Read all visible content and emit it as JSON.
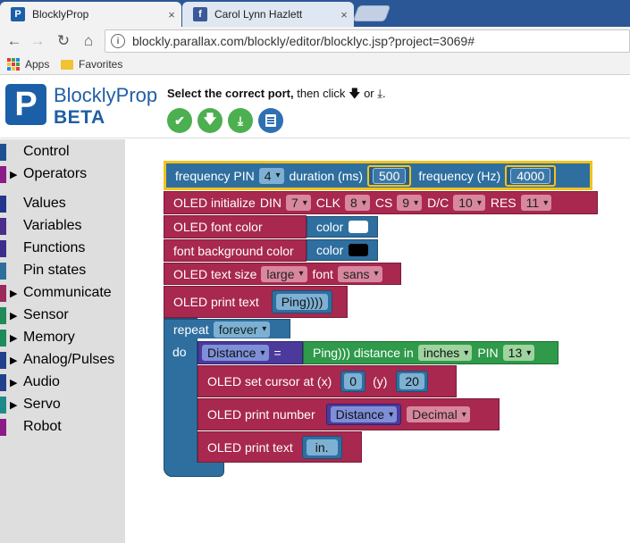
{
  "browser": {
    "tabs": [
      {
        "title": "BlocklyProp",
        "close": "×"
      },
      {
        "title": "Carol Lynn Hazlett",
        "close": "×"
      }
    ],
    "url": "blockly.parallax.com/blockly/editor/blocklyc.jsp?project=3069#",
    "bookmarks": {
      "apps": "Apps",
      "favorites": "Favorites"
    },
    "nav_icons": [
      "back-arrow-icon",
      "forward-arrow-icon",
      "reload-icon",
      "home-icon"
    ]
  },
  "header": {
    "logo_line1": "BlocklyProp",
    "logo_line2": "BETA",
    "message_bold": "Select the correct port,",
    "message_rest": "then click",
    "message_or": "or",
    "message_end": ".",
    "buttons": [
      {
        "name": "compile-button",
        "color": "#4caf50",
        "icon": "check-icon"
      },
      {
        "name": "load-ram-button",
        "color": "#4caf50",
        "icon": "download-icon"
      },
      {
        "name": "load-eeprom-button",
        "color": "#4caf50",
        "icon": "download-bar-icon"
      },
      {
        "name": "serial-terminal-button",
        "color": "#2f6fb3",
        "icon": "terminal-icon"
      }
    ]
  },
  "sidebar": {
    "categories": [
      {
        "label": "Control",
        "color": "#1f4f93",
        "arrow": false
      },
      {
        "label": "Operators",
        "color": "#8b1c88",
        "arrow": true
      },
      {
        "label": "Values",
        "color": "#23358c",
        "arrow": false
      },
      {
        "label": "Variables",
        "color": "#4b2d8c",
        "arrow": false
      },
      {
        "label": "Functions",
        "color": "#3b2d8c",
        "arrow": false
      },
      {
        "label": "Pin states",
        "color": "#2d6e9c",
        "arrow": false
      },
      {
        "label": "Communicate",
        "color": "#9b2a5a",
        "arrow": true
      },
      {
        "label": "Sensor",
        "color": "#1f8a5a",
        "arrow": true
      },
      {
        "label": "Memory",
        "color": "#1f8a5a",
        "arrow": true
      },
      {
        "label": "Analog/Pulses",
        "color": "#22418c",
        "arrow": true
      },
      {
        "label": "Audio",
        "color": "#22418c",
        "arrow": true
      },
      {
        "label": "Servo",
        "color": "#1f8a8a",
        "arrow": true
      },
      {
        "label": "Robot",
        "color": "#8b1c88",
        "arrow": false
      }
    ]
  },
  "blocks": {
    "freq": {
      "label": "frequency PIN",
      "pin": "4",
      "duration_label": "duration (ms)",
      "duration": "500",
      "freq_label": "frequency (Hz)",
      "freq": "4000"
    },
    "init": {
      "label": "OLED initialize",
      "din_label": "DIN",
      "din": "7",
      "clk_label": "CLK",
      "clk": "8",
      "cs_label": "CS",
      "cs": "9",
      "dc_label": "D/C",
      "dc": "10",
      "res_label": "RES",
      "res": "11"
    },
    "fontcolor": {
      "label": "OLED font color",
      "color_label": "color",
      "swatch": "#ffffff"
    },
    "bgcolor": {
      "label": "font background color",
      "color_label": "color",
      "swatch": "#000000"
    },
    "textsize": {
      "label": "OLED text size",
      "size": "large",
      "font_label": "font",
      "font": "sans"
    },
    "print1": {
      "label": "OLED print text",
      "text": "Ping))))"
    },
    "repeat": {
      "label": "repeat",
      "mode": "forever",
      "do": "do"
    },
    "setvar": {
      "var": "Distance",
      "eq": "=",
      "sensor": "Ping))) distance in",
      "unit": "inches",
      "pin_label": "PIN",
      "pin": "13"
    },
    "cursor": {
      "label": "OLED set cursor at (x)",
      "x": "0",
      "y_label": "(y)",
      "y": "20"
    },
    "printnum": {
      "label": "OLED print number",
      "var": "Distance",
      "format": "Decimal"
    },
    "print2": {
      "label": "OLED print text",
      "text": "in."
    }
  }
}
